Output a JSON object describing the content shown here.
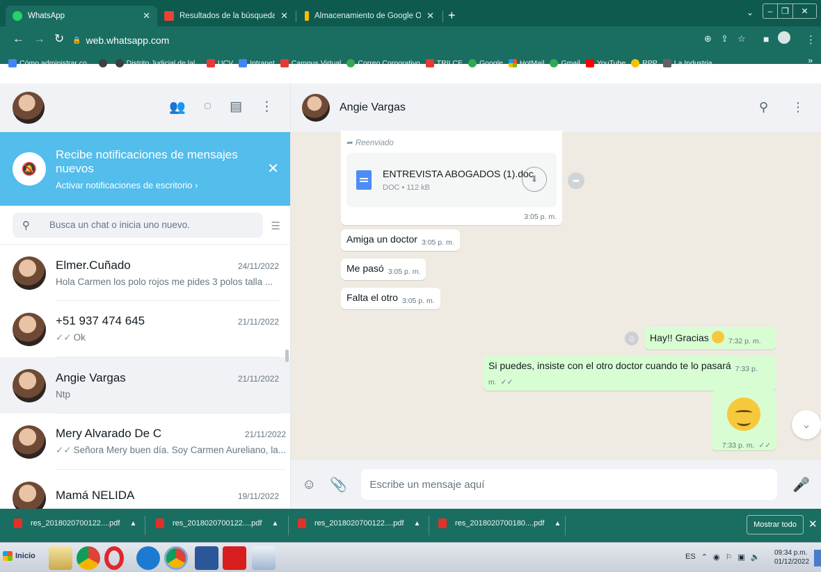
{
  "browser": {
    "tabs": [
      {
        "title": "WhatsApp",
        "icon": "whatsapp-icon",
        "color": "#25d366",
        "active": true
      },
      {
        "title": "Resultados de la búsqueda - carmen",
        "icon": "gmail-icon",
        "color": "#ea4335",
        "active": false
      },
      {
        "title": "Almacenamiento de Google One",
        "icon": "google-one-icon",
        "color": "#fbbc04",
        "active": false
      }
    ],
    "address": "web.whatsapp.com",
    "bookmarks": [
      {
        "label": "Cómo administrar co...",
        "color": "#4285f4"
      },
      {
        "label": "",
        "color": "#3c4043"
      },
      {
        "label": "Distrito Judicial de lal...",
        "color": "#3c4043"
      },
      {
        "label": "UCV",
        "color": "#e53935"
      },
      {
        "label": "Intranet",
        "color": "#4285f4"
      },
      {
        "label": "Campus Virtual",
        "color": "#e53935"
      },
      {
        "label": "Correo Corporativo",
        "color": "#34a853"
      },
      {
        "label": "TRILCE",
        "color": "#e53935"
      },
      {
        "label": "Google",
        "color": "#34a853"
      },
      {
        "label": "HotMail",
        "color": "#f25022"
      },
      {
        "label": "Gmail",
        "color": "#34a853"
      },
      {
        "label": "YouTube",
        "color": "#ff0000"
      },
      {
        "label": "RPP",
        "color": "#f6c200"
      },
      {
        "label": "La Industria",
        "color": "#5f6368"
      }
    ]
  },
  "sidebar": {
    "notification": {
      "title": "Recibe notificaciones de mensajes nuevos",
      "subtitle": "Activar notificaciones de escritorio ›"
    },
    "search_placeholder": "Busca un chat o inicia uno nuevo.",
    "chats": [
      {
        "name": "Elmer.Cuñado",
        "date": "24/11/2022",
        "last": "Hola Carmen los polo rojos  me pides 3 polos talla ...",
        "ticks": "",
        "selected": false
      },
      {
        "name": "+51 937 474 645",
        "date": "21/11/2022",
        "last": "Ok",
        "ticks": "✓✓",
        "selected": false
      },
      {
        "name": "Angie Vargas",
        "date": "21/11/2022",
        "last": "Ntp",
        "ticks": "",
        "selected": true
      },
      {
        "name": "Mery Alvarado De C",
        "date": "21/11/2022",
        "last": "Señora Mery buen día. Soy Carmen Aureliano, la...",
        "ticks": "✓✓",
        "selected": false
      },
      {
        "name": "Mamá NELIDA",
        "date": "19/11/2022",
        "last": "",
        "ticks": "",
        "selected": false
      }
    ]
  },
  "conversation": {
    "contact": "Angie Vargas",
    "forwarded_label": "Reenviado",
    "document": {
      "name": "ENTREVISTA ABOGADOS (1).doc",
      "meta": "DOC • 112 kB",
      "time": "3:05 p. m."
    },
    "incoming": [
      {
        "text": "Amiga un doctor",
        "time": "3:05 p. m."
      },
      {
        "text": "Me pasó",
        "time": "3:05 p. m."
      },
      {
        "text": "Falta el otro",
        "time": "3:05 p. m."
      }
    ],
    "outgoing": [
      {
        "text": "Hay!! Gracias",
        "time": "7:32 p. m."
      },
      {
        "text": "Si puedes, insiste con el otro doctor cuando te lo pasará",
        "time": "7:33 p. m."
      },
      {
        "text": "",
        "time": "7:33 p. m."
      }
    ],
    "composer_placeholder": "Escribe un mensaje aquí"
  },
  "downloads": {
    "items": [
      "res_2018020700122....pdf",
      "res_2018020700122....pdf",
      "res_2018020700122....pdf",
      "res_2018020700180....pdf"
    ],
    "show_all": "Mostrar todo"
  },
  "taskbar": {
    "start": "Inicio",
    "lang": "ES",
    "time": "09:34 p.m.",
    "date": "01/12/2022"
  }
}
